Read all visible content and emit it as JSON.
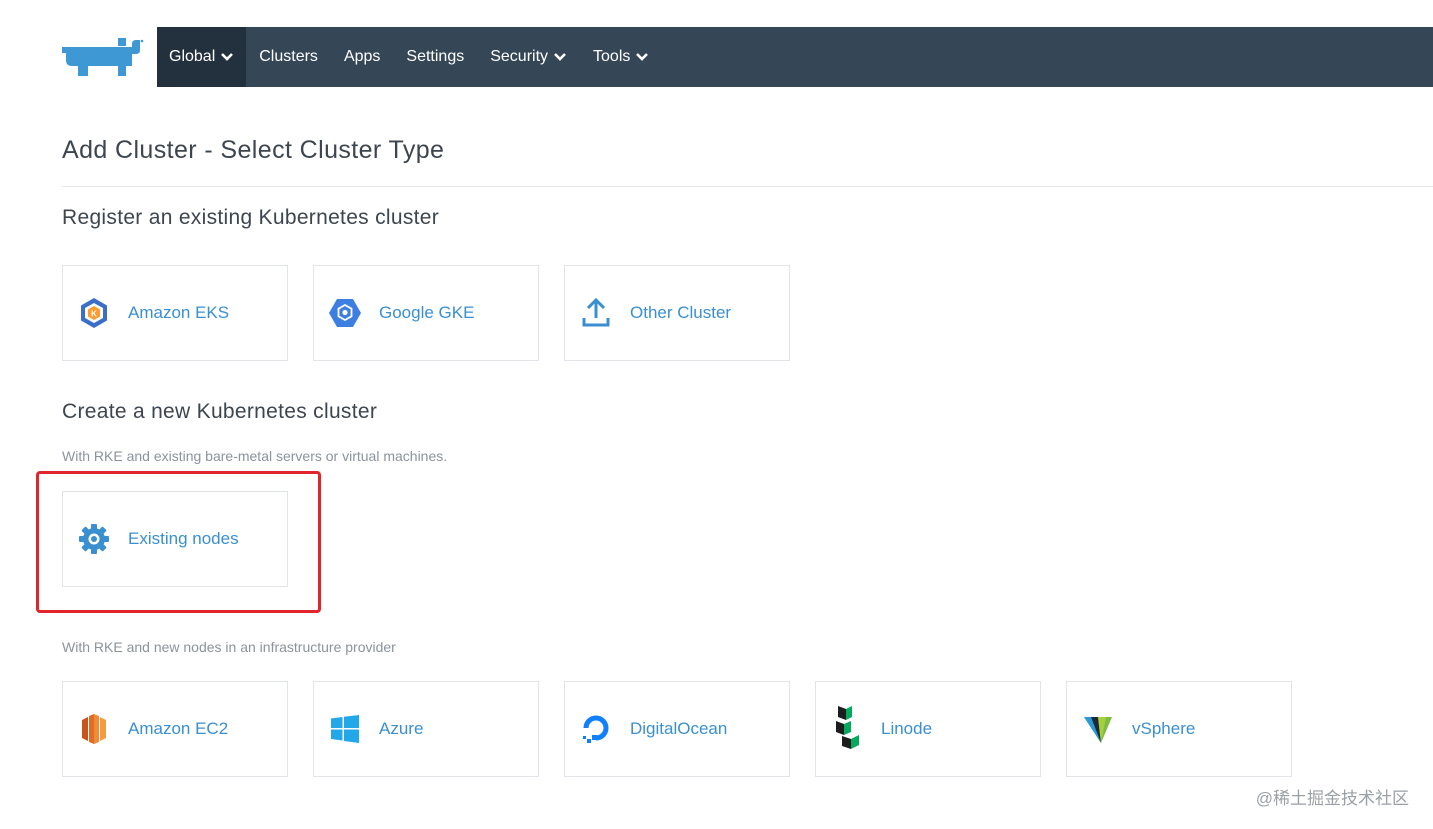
{
  "nav": {
    "items": [
      {
        "label": "Global",
        "has_dropdown": true,
        "active": true
      },
      {
        "label": "Clusters",
        "has_dropdown": false
      },
      {
        "label": "Apps",
        "has_dropdown": false
      },
      {
        "label": "Settings",
        "has_dropdown": false
      },
      {
        "label": "Security",
        "has_dropdown": true
      },
      {
        "label": "Tools",
        "has_dropdown": true
      }
    ],
    "bg_color": "#354657",
    "active_color": "#23303d"
  },
  "page_title": "Add Cluster - Select Cluster Type",
  "register_section": {
    "title": "Register an existing Kubernetes cluster",
    "cards": [
      {
        "label": "Amazon EKS",
        "icon": "amazon-eks-icon"
      },
      {
        "label": "Google GKE",
        "icon": "google-gke-icon"
      },
      {
        "label": "Other Cluster",
        "icon": "upload-icon"
      }
    ]
  },
  "create_section": {
    "title": "Create a new Kubernetes cluster",
    "existing_desc": "With RKE and existing bare-metal servers or virtual machines.",
    "existing_cards": [
      {
        "label": "Existing nodes",
        "icon": "gear-icon"
      }
    ],
    "provider_desc": "With RKE and new nodes in an infrastructure provider",
    "provider_cards": [
      {
        "label": "Amazon EC2",
        "icon": "amazon-ec2-icon"
      },
      {
        "label": "Azure",
        "icon": "windows-icon"
      },
      {
        "label": "DigitalOcean",
        "icon": "digitalocean-icon"
      },
      {
        "label": "Linode",
        "icon": "linode-icon"
      },
      {
        "label": "vSphere",
        "icon": "vsphere-icon"
      }
    ]
  },
  "accent_color": "#3a8fd1",
  "highlight_color": "#e0262c",
  "watermark": "@稀土掘金技术社区"
}
